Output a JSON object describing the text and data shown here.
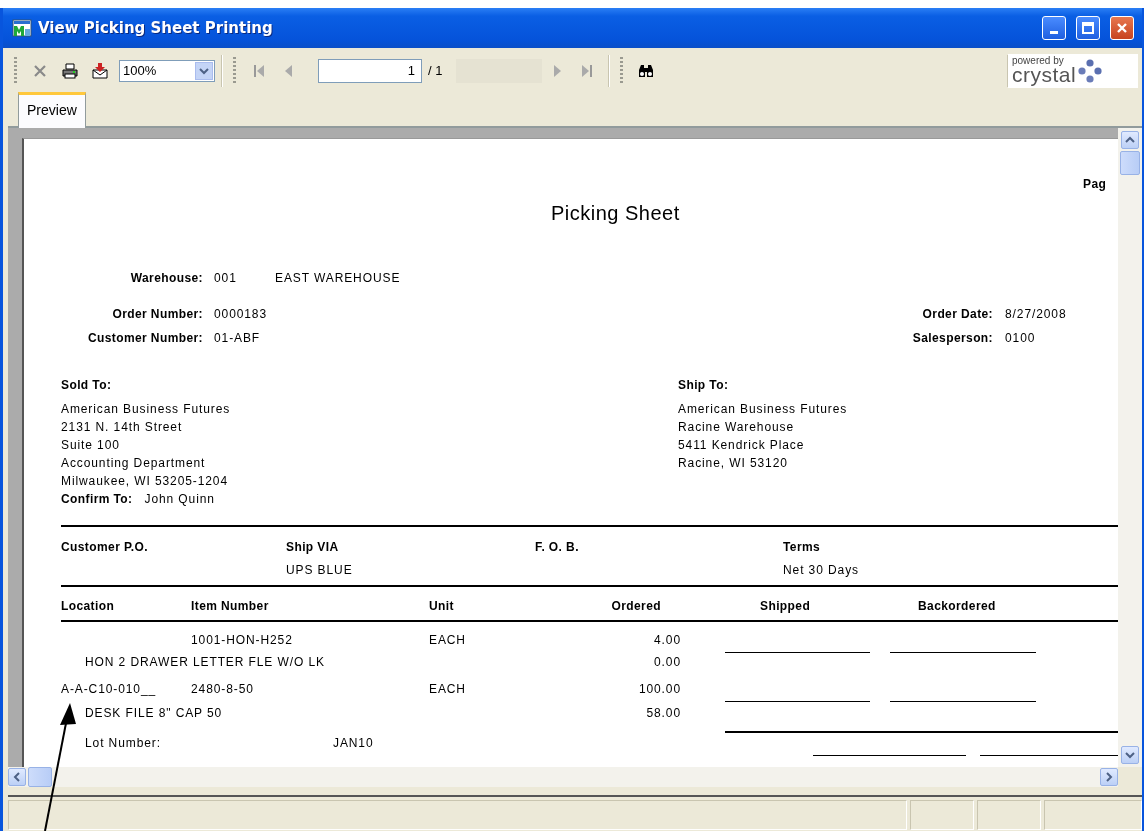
{
  "window": {
    "title": "View Picking Sheet Printing"
  },
  "toolbar": {
    "zoom": "100%",
    "page_number": "1",
    "page_total": "/ 1",
    "logo_tagline": "powered by",
    "logo_name": "crystal"
  },
  "tabs": [
    {
      "label": "Preview",
      "selected": true
    }
  ],
  "report": {
    "page_label": "Pag",
    "title": "Picking Sheet",
    "warehouse": {
      "label": "Warehouse:",
      "code": "001",
      "name": "EAST WAREHOUSE"
    },
    "left_fields": [
      {
        "label": "Order Number:",
        "value": "0000183"
      },
      {
        "label": "Customer Number:",
        "value": "01-ABF"
      }
    ],
    "right_fields": [
      {
        "label": "Order Date:",
        "value": "8/27/2008"
      },
      {
        "label": "Salesperson:",
        "value": "0100"
      }
    ],
    "sold_to": {
      "label": "Sold To:",
      "lines": [
        "American Business Futures",
        "2131 N. 14th Street",
        "Suite 100",
        "Accounting Department",
        "Milwaukee, WI 53205-1204"
      ]
    },
    "confirm_to": {
      "label": "Confirm To:",
      "value": "John Quinn"
    },
    "ship_to": {
      "label": "Ship To:",
      "lines": [
        "American Business Futures",
        "Racine Warehouse",
        "5411 Kendrick Place",
        "Racine, WI 53120"
      ]
    },
    "order_terms": [
      {
        "label": "Customer P.O."
      },
      {
        "label": "Ship VIA",
        "value": "UPS BLUE"
      },
      {
        "label": "F. O. B."
      },
      {
        "label": "Terms",
        "value": "Net 30 Days"
      }
    ],
    "columns": [
      "Location",
      "Item Number",
      "Unit",
      "Ordered",
      "Shipped",
      "Backordered"
    ],
    "lines": [
      {
        "kind": "item",
        "item_number": "1001-HON-H252",
        "unit": "EACH",
        "ordered": "4.00",
        "description": "HON 2 DRAWER LETTER FLE W/O LK",
        "quantity_2": "0.00"
      },
      {
        "kind": "item",
        "location": "A-A-C10-010__",
        "item_number": "2480-8-50",
        "unit": "EACH",
        "ordered": "100.00",
        "description": "DESK FILE 8\" CAP 50",
        "quantity_2": "58.00"
      },
      {
        "kind": "lot",
        "label": "Lot Number:",
        "value": "JAN10"
      }
    ]
  }
}
